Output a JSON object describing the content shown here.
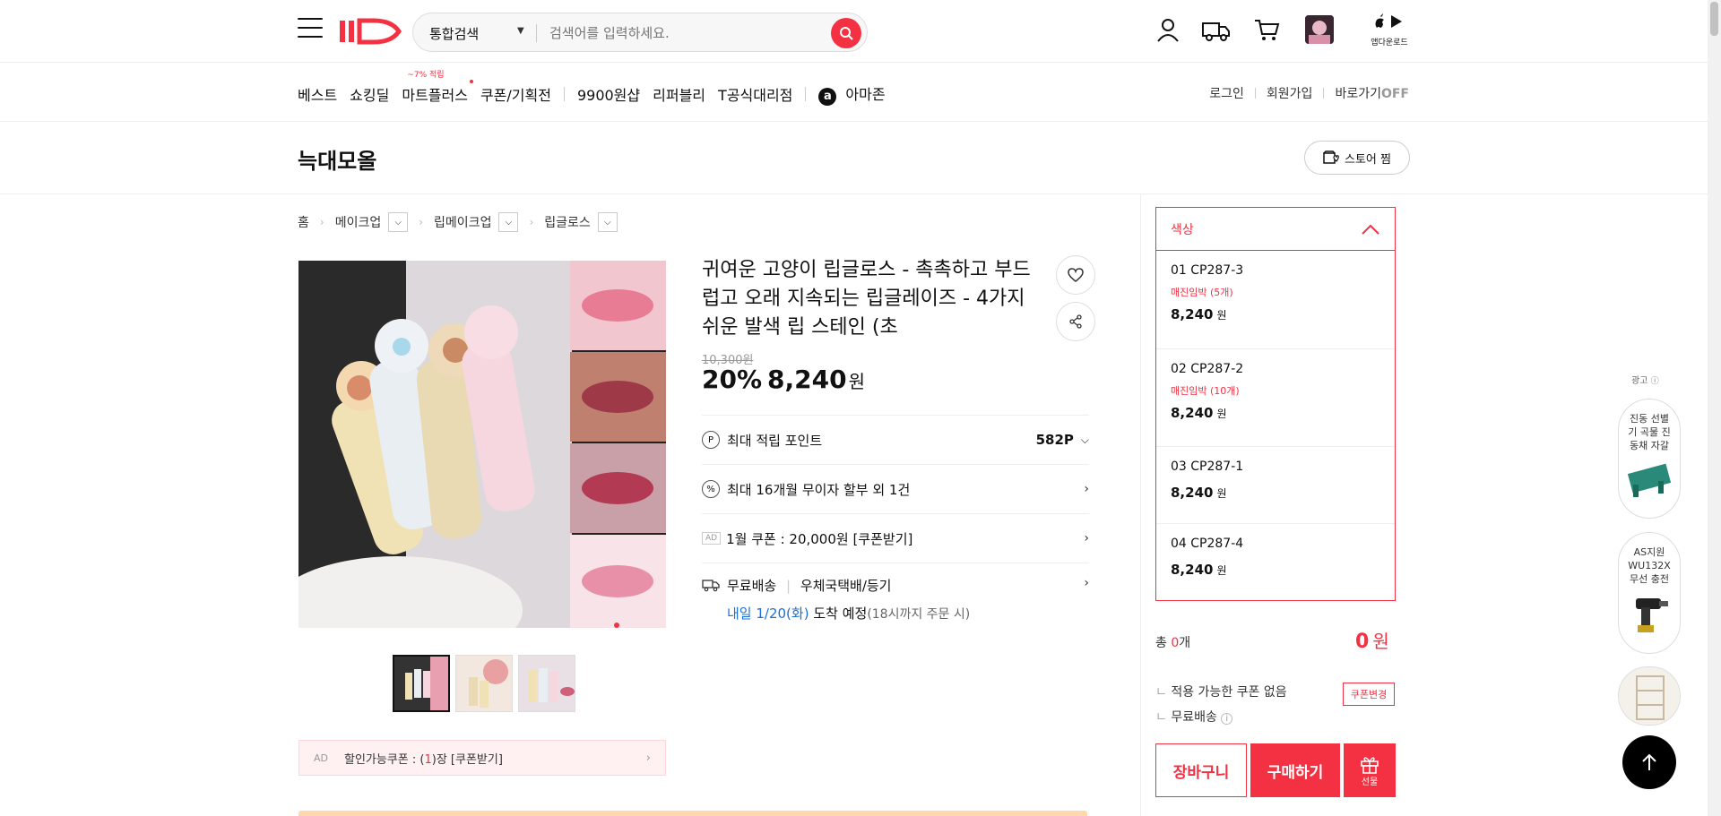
{
  "header": {
    "search": {
      "category": "통합검색",
      "placeholder": "검색어를 입력하세요."
    },
    "app_download_label": "앱다운로드"
  },
  "nav": {
    "items": [
      {
        "label": "베스트"
      },
      {
        "label": "쇼킹딜"
      },
      {
        "label": "마트플러스",
        "tag": "~7% 적립"
      },
      {
        "label": "쿠폰/기획전"
      },
      {
        "label": "9900원샵"
      },
      {
        "label": "리퍼블리"
      },
      {
        "label": "T공식대리점"
      },
      {
        "label": "아마존"
      }
    ],
    "right_links": {
      "login": "로그인",
      "signup": "회원가입",
      "shortcut": "바로가기",
      "shortcut_state": "OFF"
    }
  },
  "store": {
    "name": "늑대모올",
    "fav_label": "스토어 찜"
  },
  "breadcrumb": {
    "home": "홈",
    "level1": "메이크업",
    "level2": "립메이크업",
    "level3": "립글로스"
  },
  "product": {
    "title": "귀여운 고양이 립글로스 - 촉촉하고 부드럽고 오래 지속되는 립글레이즈 - 4가지 쉬운 발색 립 스테인 (초",
    "original_price": "10,300원",
    "discount_rate": "20%",
    "sale_price": "8,240",
    "currency": "원",
    "points_label": "최대 적립 포인트",
    "points_value": "582P",
    "installment": "최대 16개월 무이자 할부 외 1건",
    "ad_tag": "AD",
    "coupon_text": "1월 쿠폰 : 20,000원 [쿠폰받기]",
    "shipping_free": "무료배송",
    "shipping_carrier": "우체국택배/등기",
    "delivery_date": "내일 1/20(화)",
    "delivery_suffix": "도착 예정",
    "delivery_note": "(18시까지 주문 시)",
    "bottom_ad": {
      "label": "AD",
      "prefix": "할인가능쿠폰 : (",
      "count": "1",
      "suffix": ")장 [쿠폰받기]"
    }
  },
  "options": {
    "header": "색상",
    "items": [
      {
        "name": "01 CP287-3",
        "stock": "매진임박 (5개)",
        "price": "8,240",
        "unit": "원"
      },
      {
        "name": "02 CP287-2",
        "stock": "매진임박 (10개)",
        "price": "8,240",
        "unit": "원"
      },
      {
        "name": "03 CP287-1",
        "stock": "",
        "price": "8,240",
        "unit": "원"
      },
      {
        "name": "04 CP287-4",
        "stock": "",
        "price": "8,240",
        "unit": "원"
      }
    ]
  },
  "summary": {
    "total_prefix": "총 ",
    "total_count": "0",
    "total_suffix": "개",
    "total_price": "0",
    "total_unit": "원",
    "no_coupon": "적용 가능한 쿠폰 없음",
    "coupon_change": "쿠폰변경",
    "free_shipping": "무료배송"
  },
  "actions": {
    "cart": "장바구니",
    "buy": "구매하기",
    "gift": "선물"
  },
  "side_ads": {
    "label": "광고",
    "items": [
      {
        "text": "진동 선별기 곡물 진동채 자갈"
      },
      {
        "text": "AS지원 WU132X 무선 충전"
      },
      {
        "text": ""
      }
    ]
  },
  "colors": {
    "accent": "#f43142",
    "delivery_blue": "#1a6fd6"
  }
}
